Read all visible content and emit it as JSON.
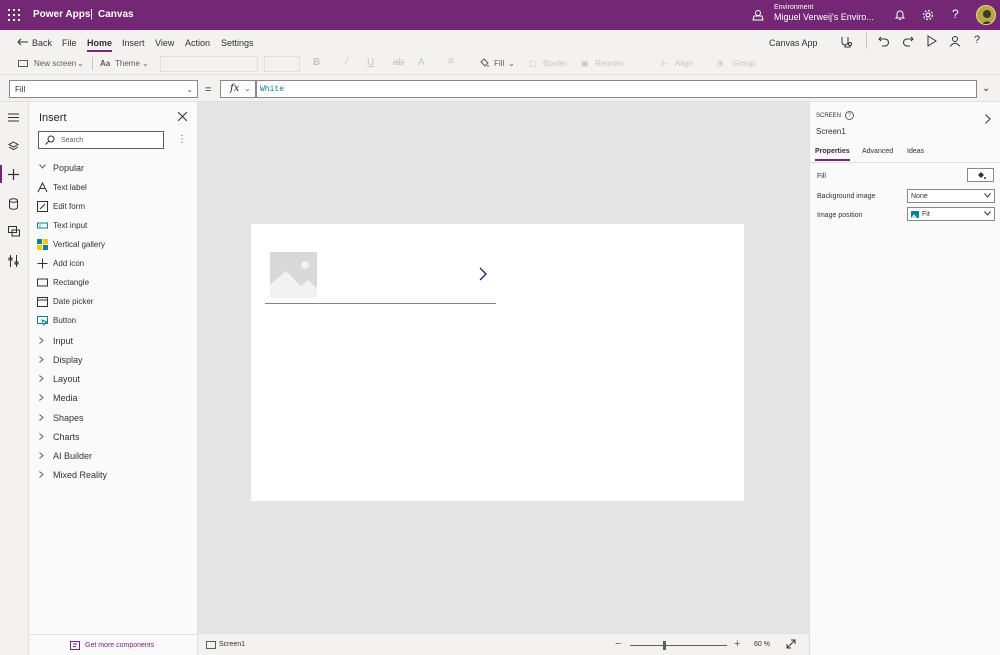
{
  "topbar": {
    "brand": "Power Apps",
    "separator": "|",
    "app_type": "Canvas",
    "environment_label": "Environment",
    "environment_name": "Miguel Verweij's Enviro...",
    "help": "?"
  },
  "menubar": {
    "back": "Back",
    "items": [
      "File",
      "Home",
      "Insert",
      "View",
      "Action",
      "Settings"
    ],
    "active": "Home",
    "app_name": "Canvas App"
  },
  "toolbar": {
    "new_screen": "New screen",
    "theme": "Theme",
    "fill": "Fill",
    "border": "Border",
    "reorder": "Reorder",
    "align": "Align",
    "group": "Group"
  },
  "formula_bar": {
    "property": "Fill",
    "equals": "=",
    "fx": "fx",
    "formula": "White"
  },
  "insert_pane": {
    "title": "Insert",
    "search_placeholder": "Search",
    "more": "⋮",
    "popular_label": "Popular",
    "popular_items": [
      {
        "label": "Text label",
        "icon": "text-label-icon"
      },
      {
        "label": "Edit form",
        "icon": "edit-form-icon"
      },
      {
        "label": "Text input",
        "icon": "text-input-icon"
      },
      {
        "label": "Vertical gallery",
        "icon": "vertical-gallery-icon"
      },
      {
        "label": "Add icon",
        "icon": "add-icon"
      },
      {
        "label": "Rectangle",
        "icon": "rectangle-icon"
      },
      {
        "label": "Date picker",
        "icon": "date-picker-icon"
      },
      {
        "label": "Button",
        "icon": "button-icon"
      }
    ],
    "categories": [
      "Input",
      "Display",
      "Layout",
      "Media",
      "Shapes",
      "Charts",
      "AI Builder",
      "Mixed Reality"
    ],
    "get_more": "Get more components"
  },
  "status_bar": {
    "screen_name": "Screen1",
    "minus": "−",
    "plus": "+",
    "zoom": "60  %",
    "zoom_fraction": 0.6
  },
  "properties_pane": {
    "kind": "SCREEN",
    "help": "?",
    "name": "Screen1",
    "tabs": [
      "Properties",
      "Advanced",
      "Ideas"
    ],
    "active_tab": "Properties",
    "rows": [
      {
        "label": "Fill"
      },
      {
        "label": "Background image",
        "value": "None"
      },
      {
        "label": "Image position",
        "value": "Fit"
      }
    ]
  },
  "colors": {
    "brand": "#742774",
    "canvas_bg": "#e5e5e5",
    "screen_fill": "#ffffff",
    "formula_text": "#0f8189",
    "gallery_separator": "#7d7cb5"
  }
}
